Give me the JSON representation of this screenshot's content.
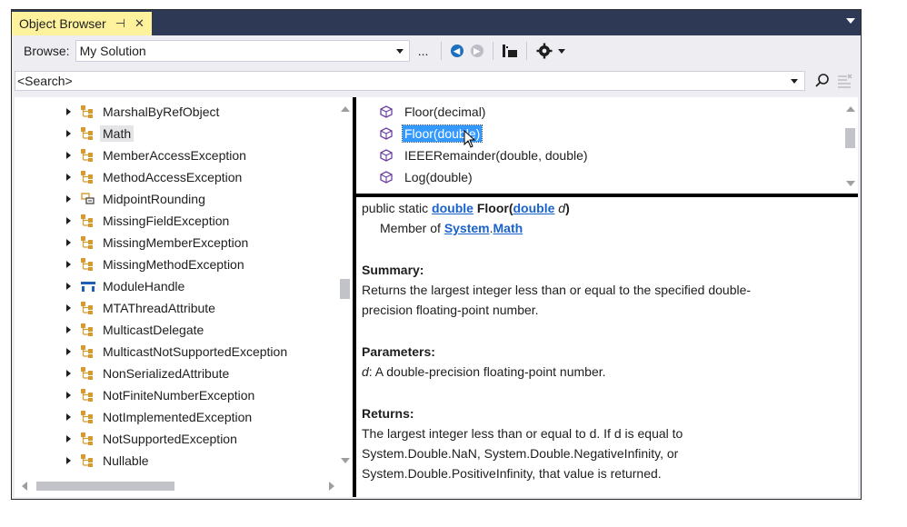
{
  "window": {
    "tab_title": "Object Browser",
    "pin_glyph": "⊣",
    "close_glyph": "✕"
  },
  "toolbar": {
    "browse_label": "Browse:",
    "browse_value": "My Solution",
    "ellipsis_label": "...",
    "icons": [
      "back-arrow-icon",
      "forward-arrow-icon",
      "add-to-references-icon",
      "settings-gear-icon"
    ]
  },
  "search": {
    "placeholder": "<Search>"
  },
  "tree": {
    "items": [
      {
        "label": "MarshalByRefObject",
        "icon": "class-icon"
      },
      {
        "label": "Math",
        "icon": "class-icon",
        "selected": true
      },
      {
        "label": "MemberAccessException",
        "icon": "class-icon"
      },
      {
        "label": "MethodAccessException",
        "icon": "class-icon"
      },
      {
        "label": "MidpointRounding",
        "icon": "enum-icon"
      },
      {
        "label": "MissingFieldException",
        "icon": "class-icon"
      },
      {
        "label": "MissingMemberException",
        "icon": "class-icon"
      },
      {
        "label": "MissingMethodException",
        "icon": "class-icon"
      },
      {
        "label": "ModuleHandle",
        "icon": "struct-icon"
      },
      {
        "label": "MTAThreadAttribute",
        "icon": "class-icon"
      },
      {
        "label": "MulticastDelegate",
        "icon": "class-icon"
      },
      {
        "label": "MulticastNotSupportedException",
        "icon": "class-icon"
      },
      {
        "label": "NonSerializedAttribute",
        "icon": "class-icon"
      },
      {
        "label": "NotFiniteNumberException",
        "icon": "class-icon"
      },
      {
        "label": "NotImplementedException",
        "icon": "class-icon"
      },
      {
        "label": "NotSupportedException",
        "icon": "class-icon"
      },
      {
        "label": "Nullable",
        "icon": "class-icon"
      }
    ]
  },
  "members": {
    "items": [
      {
        "label": "Floor(decimal)",
        "selected": false
      },
      {
        "label": "Floor(double)",
        "selected": true
      },
      {
        "label": "IEEERemainder(double, double)",
        "selected": false
      },
      {
        "label": "Log(double)",
        "selected": false
      }
    ]
  },
  "description": {
    "sig_prefix": "public static",
    "sig_return_type": "double",
    "sig_name": "Floor",
    "sig_paren_open": "(",
    "sig_param_type": "double",
    "sig_param_name": "d",
    "sig_paren_close": ")",
    "member_of_label": "Member of",
    "member_of_ns": "System",
    "member_of_dot": ".",
    "member_of_class": "Math",
    "summary_heading": "Summary:",
    "summary_line1": "Returns the largest integer less than or equal to the specified double-",
    "summary_line2": "precision floating-point number.",
    "parameters_heading": "Parameters:",
    "param_name": "d",
    "param_desc": ": A double-precision floating-point number.",
    "returns_heading": "Returns:",
    "returns_line1": "The largest integer less than or equal to d. If d is equal to",
    "returns_line2": "System.Double.NaN, System.Double.NegativeInfinity, or",
    "returns_line3": "System.Double.PositiveInfinity, that value is returned."
  },
  "colors": {
    "title_bar": "#2d3955",
    "active_tab": "#fff29d",
    "selection": "#3399ff",
    "link": "#1a62cc",
    "class_icon": "#d69a2f"
  }
}
